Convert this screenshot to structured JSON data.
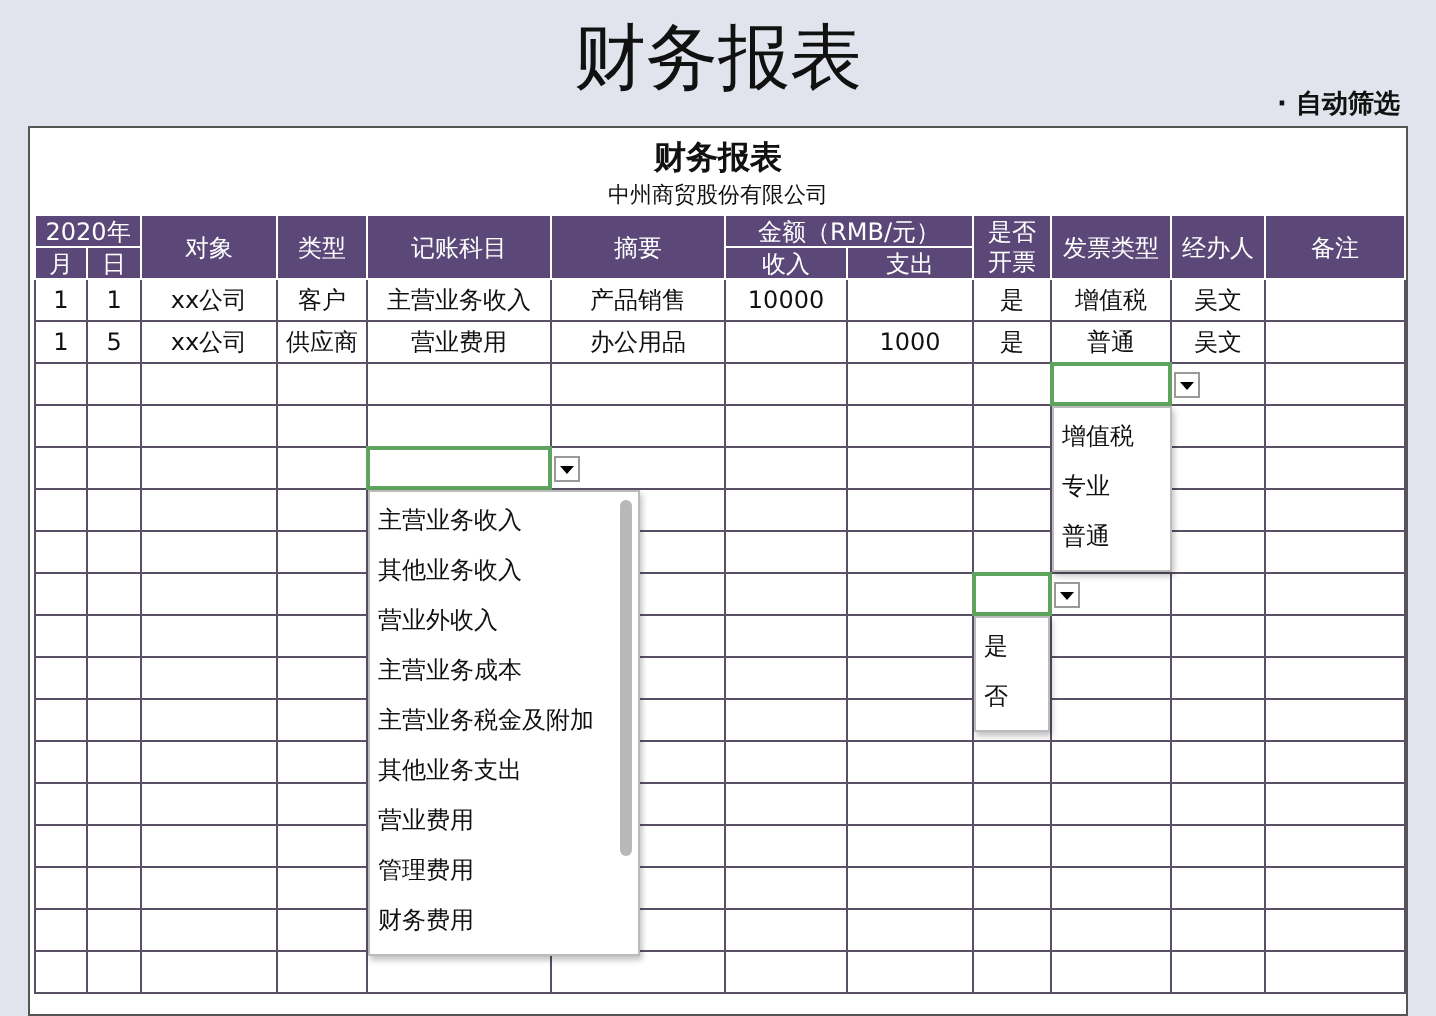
{
  "page_title": "财务报表",
  "filter_label": "· 自动筛选",
  "sheet": {
    "title": "财务报表",
    "subtitle": "中州商贸股份有限公司"
  },
  "header": {
    "year": "2020年",
    "month": "月",
    "day": "日",
    "object": "对象",
    "type": "类型",
    "account": "记账科目",
    "summary": "摘要",
    "amount": "金额（RMB/元）",
    "income": "收入",
    "expense": "支出",
    "invoiced": "是否开票",
    "invoice_type": "发票类型",
    "handler": "经办人",
    "note": "备注"
  },
  "rows": [
    {
      "cells": [
        "1",
        "1",
        "xx公司",
        "客户",
        "主营业务收入",
        "产品销售",
        "10000",
        null,
        "是",
        "增值税",
        "吴文",
        null
      ]
    },
    {
      "cells": [
        "1",
        "5",
        "xx公司",
        "供应商",
        "营业费用",
        "办公用品",
        null,
        "1000",
        "是",
        "普通",
        "吴文",
        null
      ]
    },
    {
      "cells": [
        null,
        null,
        null,
        null,
        null,
        null,
        null,
        null,
        null,
        {
          "dropdown": {
            "kind": "plain",
            "options": [
              "增值税",
              "专业",
              "普通"
            ]
          }
        },
        null,
        null
      ]
    },
    {
      "cells": [
        null,
        null,
        null,
        null,
        null,
        null,
        null,
        null,
        null,
        null,
        null,
        null
      ]
    },
    {
      "cells": [
        null,
        null,
        null,
        null,
        {
          "dropdown": {
            "kind": "scrolling",
            "options": [
              "主营业务收入",
              "其他业务收入",
              "营业外收入",
              "主营业务成本",
              "主营业务税金及附加",
              "其他业务支出",
              "营业费用",
              "管理费用",
              "财务费用"
            ]
          }
        },
        null,
        null,
        null,
        null,
        null,
        null,
        null
      ]
    },
    {
      "cells": [
        null,
        null,
        null,
        null,
        null,
        null,
        null,
        null,
        null,
        null,
        null,
        null
      ]
    },
    {
      "cells": [
        null,
        null,
        null,
        null,
        null,
        null,
        null,
        null,
        null,
        null,
        null,
        null
      ]
    },
    {
      "cells": [
        null,
        null,
        null,
        null,
        null,
        null,
        null,
        null,
        {
          "dropdown": {
            "kind": "plain",
            "options": [
              "是",
              "否"
            ]
          }
        },
        null,
        null,
        null
      ]
    },
    {
      "cells": [
        null,
        null,
        null,
        null,
        null,
        null,
        null,
        null,
        null,
        null,
        null,
        null
      ]
    },
    {
      "cells": [
        null,
        null,
        null,
        null,
        null,
        null,
        null,
        null,
        null,
        null,
        null,
        null
      ]
    },
    {
      "cells": [
        null,
        null,
        null,
        null,
        null,
        null,
        null,
        null,
        null,
        null,
        null,
        null
      ]
    },
    {
      "cells": [
        null,
        null,
        null,
        null,
        null,
        null,
        null,
        null,
        null,
        null,
        null,
        null
      ]
    },
    {
      "cells": [
        null,
        null,
        null,
        null,
        null,
        null,
        null,
        null,
        null,
        null,
        null,
        null
      ]
    },
    {
      "cells": [
        null,
        null,
        null,
        null,
        null,
        null,
        null,
        null,
        null,
        null,
        null,
        null
      ]
    },
    {
      "cells": [
        null,
        null,
        null,
        null,
        null,
        null,
        null,
        null,
        null,
        null,
        null,
        null
      ]
    },
    {
      "cells": [
        null,
        null,
        null,
        null,
        null,
        null,
        null,
        null,
        null,
        null,
        null,
        null
      ]
    },
    {
      "cells": [
        null,
        null,
        null,
        null,
        null,
        null,
        null,
        null,
        null,
        null,
        null,
        null
      ]
    }
  ]
}
